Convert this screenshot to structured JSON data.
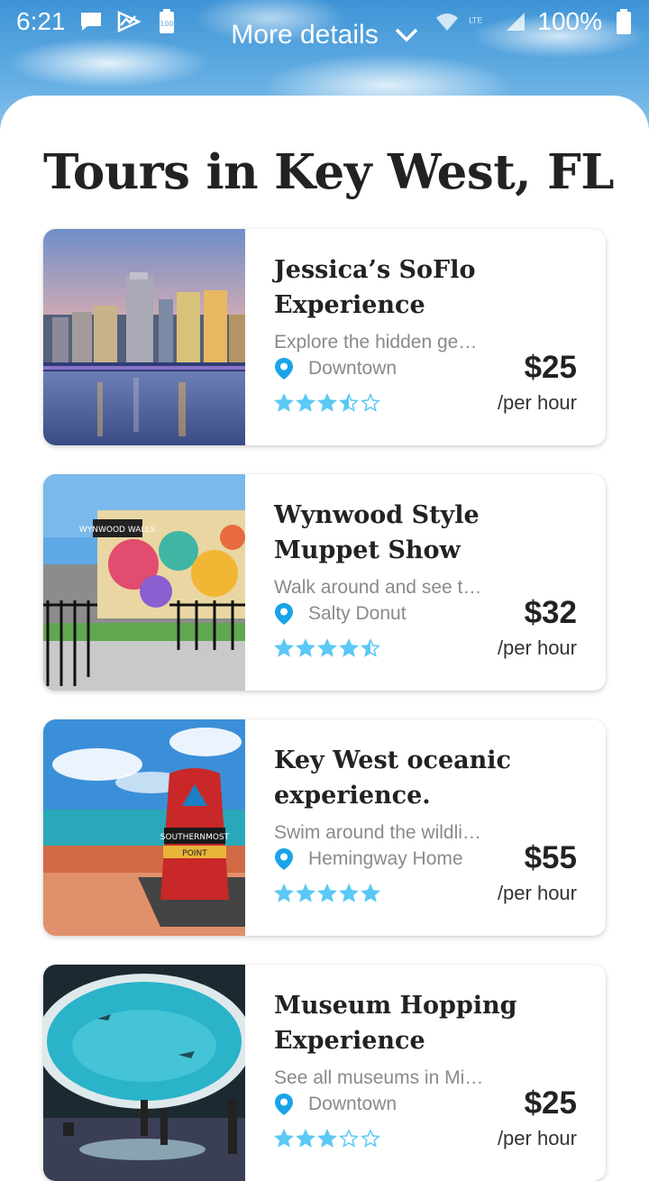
{
  "status_bar": {
    "time": "6:21",
    "battery_text": "100%",
    "icons": [
      "chat-icon",
      "activity-icon",
      "battery-saver-icon",
      "wifi-icon",
      "lte-icon",
      "signal-icon",
      "battery-icon"
    ]
  },
  "header": {
    "more_details_label": "More details",
    "chevron_icon": "chevron-down-icon"
  },
  "page": {
    "title": "Tours in Key West, FL"
  },
  "colors": {
    "accent": "#1aa3e8",
    "star": "#5bc8f5",
    "text_primary": "#222222",
    "text_secondary": "#8a8a8a"
  },
  "tours": [
    {
      "title": "Jessica’s SoFlo Experience",
      "description": "Explore the hidden ge…",
      "location": "Downtown",
      "rating": 3.5,
      "price": "$25",
      "unit": "/per hour",
      "image": "city-skyline-image"
    },
    {
      "title": "Wynwood Style Muppet Show",
      "description": "Walk around and see t…",
      "location": "Salty Donut",
      "rating": 4.5,
      "price": "$32",
      "unit": "/per hour",
      "image": "wynwood-walls-image"
    },
    {
      "title": "Key West oceanic experience.",
      "description": "Swim around the wildli…",
      "location": "Hemingway Home",
      "rating": 5,
      "price": "$55",
      "unit": "/per hour",
      "image": "southernmost-point-image"
    },
    {
      "title": "Museum Hopping Experience",
      "description": "See all museums in Mi…",
      "location": "Downtown",
      "rating": 3,
      "price": "$25",
      "unit": "/per hour",
      "image": "aquarium-image"
    }
  ]
}
